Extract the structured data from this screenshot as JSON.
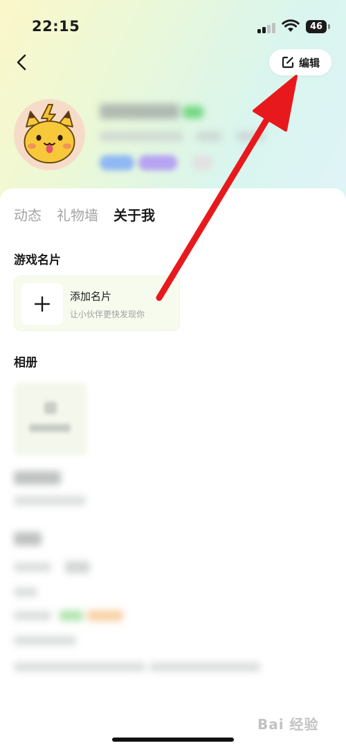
{
  "status_bar": {
    "time": "22:15",
    "battery": "46"
  },
  "header": {
    "edit_label": "编辑"
  },
  "tabs": [
    {
      "label": "动态",
      "active": false
    },
    {
      "label": "礼物墙",
      "active": false
    },
    {
      "label": "关于我",
      "active": true
    }
  ],
  "game_cards": {
    "title": "游戏名片",
    "add_title": "添加名片",
    "add_subtitle": "让小伙伴更快发现你"
  },
  "album": {
    "title": "相册"
  },
  "watermark": "Bai 经验",
  "colors": {
    "annotation_arrow": "#e8191c",
    "active_tab": "#1b1b1b",
    "inactive_tab": "#a3a3a3"
  }
}
